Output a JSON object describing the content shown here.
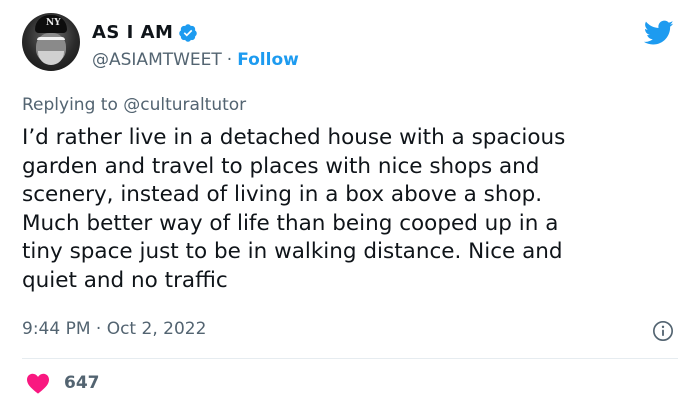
{
  "author": {
    "display_name": "AS I AM",
    "handle": "@ASIAMTWEET",
    "separator": "·",
    "follow_label": "Follow",
    "cap_text": "NY"
  },
  "reply": {
    "prefix": "Replying to",
    "mention": "@culturaltutor"
  },
  "tweet": {
    "text": "I’d rather live in a detached house with a spacious\ngarden and travel to places with nice shops and\nscenery, instead of living in a box above a shop.\nMuch better way of life than being cooped up in a\ntiny space just to be in walking distance. Nice and\nquiet and no traffic"
  },
  "meta": {
    "timestamp": "9:44 PM · Oct 2, 2022"
  },
  "engagement": {
    "likes": "647"
  },
  "colors": {
    "accent": "#1d9bf0",
    "heart": "#f91880",
    "muted": "#536471"
  },
  "icons": {
    "brand": "twitter-bird-icon",
    "verified": "verified-badge-icon",
    "info": "info-icon",
    "like": "heart-icon"
  }
}
